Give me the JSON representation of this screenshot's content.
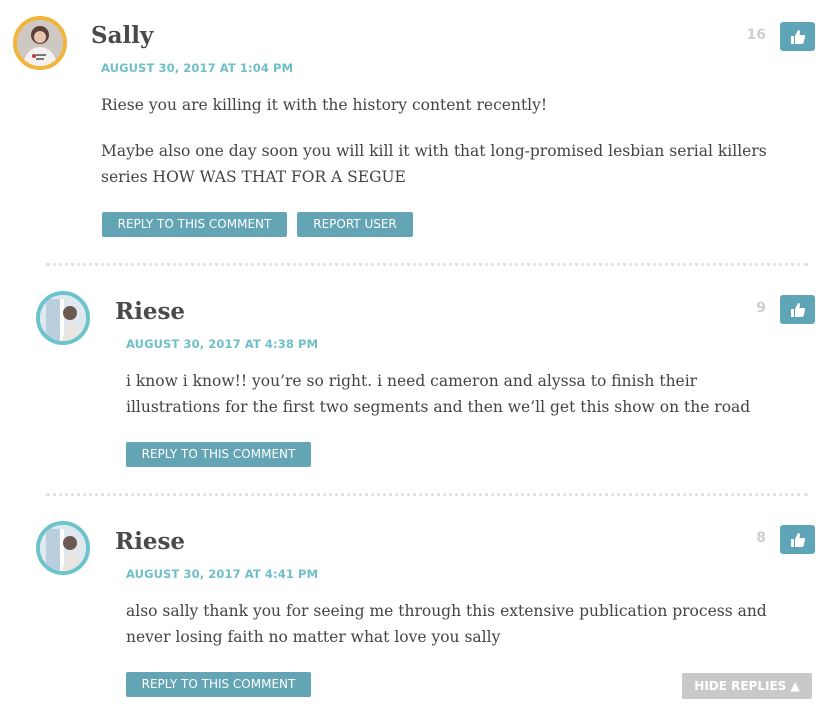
{
  "comments": [
    {
      "author": "Sally",
      "date": "AUGUST 30, 2017 AT 1:04 PM",
      "votes": "16",
      "paragraphs": [
        "Riese you are killing it with the history content recently!",
        "Maybe also one day soon you will kill it with that long-promised lesbian serial killers series HOW WAS THAT FOR A SEGUE"
      ],
      "reply_label": "REPLY TO THIS COMMENT",
      "report_label": "REPORT USER"
    },
    {
      "author": "Riese",
      "date": "AUGUST 30, 2017 AT 4:38 PM",
      "votes": "9",
      "paragraphs": [
        "i know i know!! you’re so right. i need cameron and alyssa to finish their illustrations for the first two segments and then we’ll get this show on the road"
      ],
      "reply_label": "REPLY TO THIS COMMENT"
    },
    {
      "author": "Riese",
      "date": "AUGUST 30, 2017 AT 4:41 PM",
      "votes": "8",
      "paragraphs": [
        "also sally thank you for seeing me through this extensive publication process and never losing faith no matter what love you sally"
      ],
      "reply_label": "REPLY TO THIS COMMENT"
    }
  ],
  "hide_replies_label": "HIDE REPLIES ▲",
  "icons": {
    "vote": "thumbs-up-icon"
  },
  "colors": {
    "accent": "#63a4b5",
    "date": "#6fbfc9",
    "avatar_ring_sally": "#f0b53a",
    "avatar_ring_riese": "#6cc3cc"
  }
}
